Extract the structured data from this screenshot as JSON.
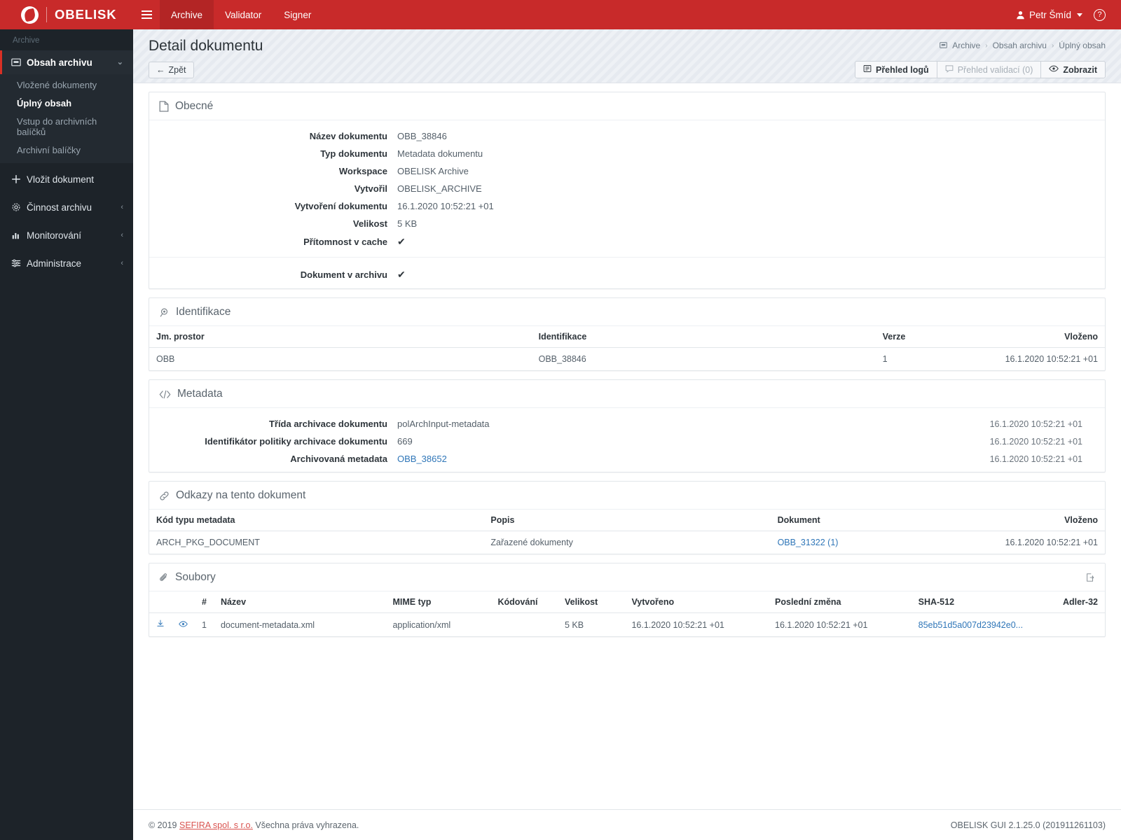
{
  "topbar": {
    "brand": "OBELISK",
    "menu_icon": "hamburger-icon",
    "nav": [
      {
        "label": "Archive",
        "active": true
      },
      {
        "label": "Validator",
        "active": false
      },
      {
        "label": "Signer",
        "active": false
      }
    ],
    "user": "Petr Šmíd",
    "help_glyph": "?"
  },
  "sidebar": {
    "title": "Archive",
    "group": {
      "label": "Obsah archivu",
      "icon": "archive-box-icon",
      "chevron": "⌄",
      "items": [
        {
          "label": "Vložené dokumenty",
          "current": false
        },
        {
          "label": "Úplný obsah",
          "current": true
        },
        {
          "label": "Vstup do archivních balíčků",
          "current": false
        },
        {
          "label": "Archivní balíčky",
          "current": false
        }
      ]
    },
    "items": [
      {
        "label": "Vložit dokument",
        "icon": "plus-icon",
        "chevron": ""
      },
      {
        "label": "Činnost archivu",
        "icon": "gear-icon",
        "chevron": "‹"
      },
      {
        "label": "Monitorování",
        "icon": "chart-bar-icon",
        "chevron": "‹"
      },
      {
        "label": "Administrace",
        "icon": "sliders-icon",
        "chevron": "‹"
      }
    ]
  },
  "page": {
    "title": "Detail dokumentu",
    "back_label": "Zpět",
    "breadcrumb": [
      {
        "label": "Archive",
        "icon": "archive-box-icon"
      },
      {
        "label": "Obsah archivu",
        "icon": ""
      },
      {
        "label": "Úplný obsah",
        "icon": ""
      }
    ],
    "actions": [
      {
        "label": "Přehled logů",
        "icon": "log-list-icon",
        "disabled": false
      },
      {
        "label": "Přehled validací (0)",
        "icon": "comment-icon",
        "disabled": true
      },
      {
        "label": "Zobrazit",
        "icon": "eye-icon",
        "disabled": false
      }
    ]
  },
  "general": {
    "heading": "Obecné",
    "icon": "file-icon",
    "rows": [
      {
        "label": "Název dokumentu",
        "value": "OBB_38846"
      },
      {
        "label": "Typ dokumentu",
        "value": "Metadata dokumentu"
      },
      {
        "label": "Workspace",
        "value": "OBELISK Archive"
      },
      {
        "label": "Vytvořil",
        "value": "OBELISK_ARCHIVE"
      },
      {
        "label": "Vytvoření dokumentu",
        "value": "16.1.2020 10:52:21 +01"
      },
      {
        "label": "Velikost",
        "value": "5 KB"
      },
      {
        "label": "Přítomnost v cache",
        "value": "✔"
      },
      {
        "label": "Dokument v archivu",
        "value": "✔"
      }
    ]
  },
  "identification": {
    "heading": "Identifikace",
    "icon": "fingerprint-icon",
    "columns": [
      "Jm. prostor",
      "Identifikace",
      "Verze",
      "Vloženo"
    ],
    "rows": [
      {
        "namespace": "OBB",
        "identifier": "OBB_38846",
        "version": "1",
        "inserted": "16.1.2020 10:52:21 +01"
      }
    ]
  },
  "metadata": {
    "heading": "Metadata",
    "icon": "code-icon",
    "rows": [
      {
        "label": "Třída archivace dokumentu",
        "value": "polArchInput-metadata",
        "link": false,
        "time": "16.1.2020 10:52:21 +01"
      },
      {
        "label": "Identifikátor politiky archivace dokumentu",
        "value": "669",
        "link": false,
        "time": "16.1.2020 10:52:21 +01"
      },
      {
        "label": "Archivovaná metadata",
        "value": "OBB_38652",
        "link": true,
        "time": "16.1.2020 10:52:21 +01"
      }
    ]
  },
  "links": {
    "heading": "Odkazy na tento dokument",
    "icon": "link-icon",
    "columns": [
      "Kód typu metadata",
      "Popis",
      "Dokument",
      "Vloženo"
    ],
    "rows": [
      {
        "code": "ARCH_PKG_DOCUMENT",
        "description": "Zařazené dokumenty",
        "document": "OBB_31322 (1)",
        "inserted": "16.1.2020 10:52:21 +01"
      }
    ]
  },
  "files": {
    "heading": "Soubory",
    "icon": "paperclip-icon",
    "export_icon": "export-icon",
    "columns": [
      "#",
      "Název",
      "MIME typ",
      "Kódování",
      "Velikost",
      "Vytvořeno",
      "Poslední změna",
      "SHA-512",
      "Adler-32"
    ],
    "rows": [
      {
        "download_icon": "download-icon",
        "preview_icon": "eye-icon",
        "num": "1",
        "name": "document-metadata.xml",
        "mime": "application/xml",
        "encoding": "",
        "size": "5 KB",
        "created": "16.1.2020 10:52:21 +01",
        "modified": "16.1.2020 10:52:21 +01",
        "sha512": "85eb51d5a007d23942e0...",
        "adler32": ""
      }
    ]
  },
  "footer": {
    "copyright_prefix": "© 2019",
    "company": "SEFIRA spol. s r.o.",
    "rights": "Všechna práva vyhrazena.",
    "version": "OBELISK GUI 2.1.25.0 (201911261103)"
  },
  "colors": {
    "brand_red": "#c82a2a",
    "sidebar_dark": "#1d2329",
    "link_blue": "#2f76b8",
    "accent_red": "#d93025"
  }
}
